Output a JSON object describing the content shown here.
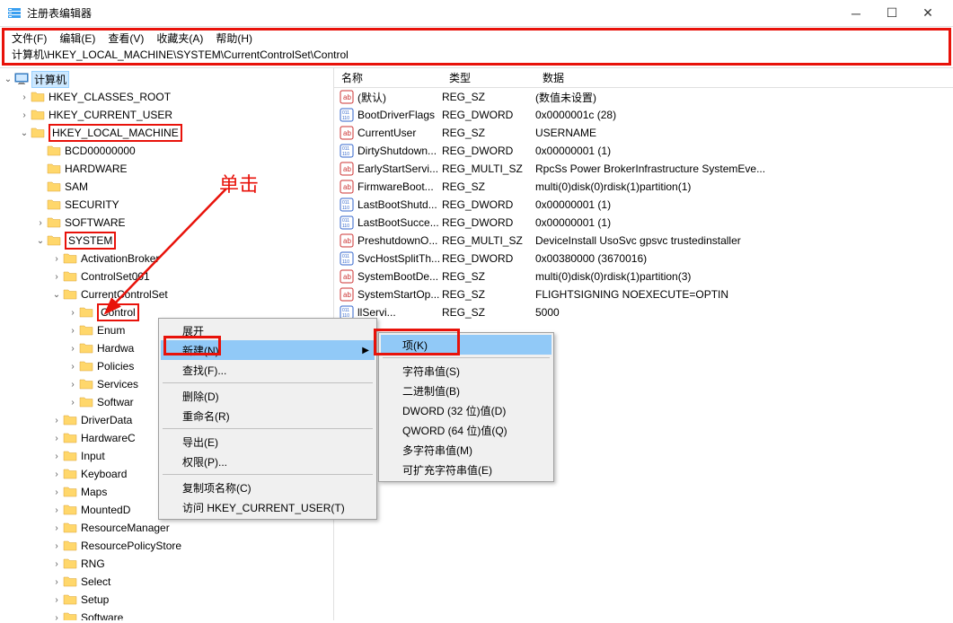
{
  "window": {
    "title": "注册表编辑器",
    "menus": [
      "文件(F)",
      "编辑(E)",
      "查看(V)",
      "收藏夹(A)",
      "帮助(H)"
    ],
    "address": "计算机\\HKEY_LOCAL_MACHINE\\SYSTEM\\CurrentControlSet\\Control"
  },
  "tree": {
    "root": "计算机",
    "items": [
      {
        "d": 1,
        "e": "open",
        "t": "计算机",
        "icon": "monitor",
        "sel": true
      },
      {
        "d": 2,
        "e": "closed",
        "t": "HKEY_CLASSES_ROOT"
      },
      {
        "d": 2,
        "e": "closed",
        "t": "HKEY_CURRENT_USER"
      },
      {
        "d": 2,
        "e": "open",
        "t": "HKEY_LOCAL_MACHINE",
        "box": true
      },
      {
        "d": 3,
        "e": "none",
        "t": "BCD00000000"
      },
      {
        "d": 3,
        "e": "none",
        "t": "HARDWARE"
      },
      {
        "d": 3,
        "e": "none",
        "t": "SAM"
      },
      {
        "d": 3,
        "e": "none",
        "t": "SECURITY"
      },
      {
        "d": 3,
        "e": "closed",
        "t": "SOFTWARE"
      },
      {
        "d": 3,
        "e": "open",
        "t": "SYSTEM",
        "box": true
      },
      {
        "d": 4,
        "e": "closed",
        "t": "ActivationBroker"
      },
      {
        "d": 4,
        "e": "closed",
        "t": "ControlSet001"
      },
      {
        "d": 4,
        "e": "open",
        "t": "CurrentControlSet"
      },
      {
        "d": 5,
        "e": "closed",
        "t": "Control",
        "box": true
      },
      {
        "d": 5,
        "e": "closed",
        "t": "Enum"
      },
      {
        "d": 5,
        "e": "closed",
        "t": "Hardwa"
      },
      {
        "d": 5,
        "e": "closed",
        "t": "Policies"
      },
      {
        "d": 5,
        "e": "closed",
        "t": "Services"
      },
      {
        "d": 5,
        "e": "closed",
        "t": "Softwar"
      },
      {
        "d": 4,
        "e": "closed",
        "t": "DriverData"
      },
      {
        "d": 4,
        "e": "closed",
        "t": "HardwareC"
      },
      {
        "d": 4,
        "e": "closed",
        "t": "Input"
      },
      {
        "d": 4,
        "e": "closed",
        "t": "Keyboard"
      },
      {
        "d": 4,
        "e": "closed",
        "t": "Maps"
      },
      {
        "d": 4,
        "e": "closed",
        "t": "MountedD"
      },
      {
        "d": 4,
        "e": "closed",
        "t": "ResourceManager"
      },
      {
        "d": 4,
        "e": "closed",
        "t": "ResourcePolicyStore"
      },
      {
        "d": 4,
        "e": "closed",
        "t": "RNG"
      },
      {
        "d": 4,
        "e": "closed",
        "t": "Select"
      },
      {
        "d": 4,
        "e": "closed",
        "t": "Setup"
      },
      {
        "d": 4,
        "e": "closed",
        "t": "Software"
      }
    ]
  },
  "list": {
    "headers": {
      "name": "名称",
      "type": "类型",
      "data": "数据"
    },
    "rows": [
      {
        "i": "s",
        "n": "(默认)",
        "t": "REG_SZ",
        "d": "(数值未设置)"
      },
      {
        "i": "d",
        "n": "BootDriverFlags",
        "t": "REG_DWORD",
        "d": "0x0000001c (28)"
      },
      {
        "i": "s",
        "n": "CurrentUser",
        "t": "REG_SZ",
        "d": "USERNAME"
      },
      {
        "i": "d",
        "n": "DirtyShutdown...",
        "t": "REG_DWORD",
        "d": "0x00000001 (1)"
      },
      {
        "i": "s",
        "n": "EarlyStartServi...",
        "t": "REG_MULTI_SZ",
        "d": "RpcSs Power BrokerInfrastructure SystemEve..."
      },
      {
        "i": "s",
        "n": "FirmwareBoot...",
        "t": "REG_SZ",
        "d": "multi(0)disk(0)rdisk(1)partition(1)"
      },
      {
        "i": "d",
        "n": "LastBootShutd...",
        "t": "REG_DWORD",
        "d": "0x00000001 (1)"
      },
      {
        "i": "d",
        "n": "LastBootSucce...",
        "t": "REG_DWORD",
        "d": "0x00000001 (1)"
      },
      {
        "i": "s",
        "n": "PreshutdownO...",
        "t": "REG_MULTI_SZ",
        "d": "DeviceInstall UsoSvc gpsvc trustedinstaller"
      },
      {
        "i": "d",
        "n": "SvcHostSplitTh...",
        "t": "REG_DWORD",
        "d": "0x00380000 (3670016)"
      },
      {
        "i": "s",
        "n": "SystemBootDe...",
        "t": "REG_SZ",
        "d": "multi(0)disk(0)rdisk(1)partition(3)"
      },
      {
        "i": "s",
        "n": "SystemStartOp...",
        "t": "REG_SZ",
        "d": " FLIGHTSIGNING  NOEXECUTE=OPTIN"
      },
      {
        "i": "d",
        "n": "llServi...",
        "t": "REG_SZ",
        "d": "5000"
      }
    ]
  },
  "ctx1": {
    "items": [
      {
        "t": "展开"
      },
      {
        "t": "新建(N)",
        "sub": true,
        "hi": true,
        "box": true
      },
      {
        "t": "查找(F)..."
      },
      {
        "sep": true
      },
      {
        "t": "删除(D)"
      },
      {
        "t": "重命名(R)"
      },
      {
        "sep": true
      },
      {
        "t": "导出(E)"
      },
      {
        "t": "权限(P)..."
      },
      {
        "sep": true
      },
      {
        "t": "复制项名称(C)"
      },
      {
        "t": "访问 HKEY_CURRENT_USER(T)"
      }
    ]
  },
  "ctx2": {
    "items": [
      {
        "t": "项(K)",
        "hi": true,
        "box": true
      },
      {
        "sep": true
      },
      {
        "t": "字符串值(S)"
      },
      {
        "t": "二进制值(B)"
      },
      {
        "t": "DWORD (32 位)值(D)"
      },
      {
        "t": "QWORD (64 位)值(Q)"
      },
      {
        "t": "多字符串值(M)"
      },
      {
        "t": "可扩充字符串值(E)"
      }
    ]
  },
  "annotation": {
    "click": "单击"
  }
}
